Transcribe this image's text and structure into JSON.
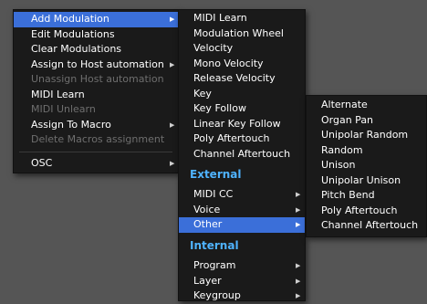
{
  "menu1": {
    "items": [
      {
        "label": "Add Modulation",
        "state": "highlight",
        "submenu": true
      },
      {
        "label": "Edit Modulations",
        "state": "normal",
        "submenu": false
      },
      {
        "label": "Clear Modulations",
        "state": "normal",
        "submenu": false
      },
      {
        "label": "Assign to Host automation",
        "state": "normal",
        "submenu": true
      },
      {
        "label": "Unassign Host automation",
        "state": "disabled",
        "submenu": false
      },
      {
        "label": "MIDI Learn",
        "state": "normal",
        "submenu": false
      },
      {
        "label": "MIDI Unlearn",
        "state": "disabled",
        "submenu": false
      },
      {
        "label": "Assign To Macro",
        "state": "normal",
        "submenu": true
      },
      {
        "label": "Delete Macros assignment",
        "state": "disabled",
        "submenu": false
      },
      {
        "label": "OSC",
        "state": "normal",
        "submenu": true
      }
    ]
  },
  "menu2": {
    "items": [
      {
        "label": "MIDI Learn"
      },
      {
        "label": "Modulation Wheel"
      },
      {
        "label": "Velocity"
      },
      {
        "label": "Mono Velocity"
      },
      {
        "label": "Release Velocity"
      },
      {
        "label": "Key"
      },
      {
        "label": "Key Follow"
      },
      {
        "label": "Linear Key Follow"
      },
      {
        "label": "Poly Aftertouch"
      },
      {
        "label": "Channel Aftertouch"
      }
    ],
    "external_header": "External",
    "external_items": [
      {
        "label": "MIDI CC",
        "submenu": true
      },
      {
        "label": "Voice",
        "submenu": true
      },
      {
        "label": "Other",
        "submenu": true,
        "state": "highlight"
      }
    ],
    "internal_header": "Internal",
    "internal_items": [
      {
        "label": "Program",
        "submenu": true
      },
      {
        "label": "Layer",
        "submenu": true
      },
      {
        "label": "Keygroup",
        "submenu": true
      }
    ]
  },
  "menu3": {
    "items": [
      {
        "label": "Alternate"
      },
      {
        "label": "Organ Pan"
      },
      {
        "label": "Unipolar Random"
      },
      {
        "label": "Random"
      },
      {
        "label": "Unison"
      },
      {
        "label": "Unipolar Unison"
      },
      {
        "label": "Pitch Bend"
      },
      {
        "label": "Poly Aftertouch"
      },
      {
        "label": "Channel Aftertouch"
      }
    ]
  },
  "icons": {
    "submenu_arrow": "▶"
  },
  "colors": {
    "highlight": "#3b6fd9",
    "section_header": "#4fb3ff",
    "disabled_text": "#6e6e6e",
    "menu_bg": "#1a1a1a",
    "desktop_bg": "#555555"
  }
}
